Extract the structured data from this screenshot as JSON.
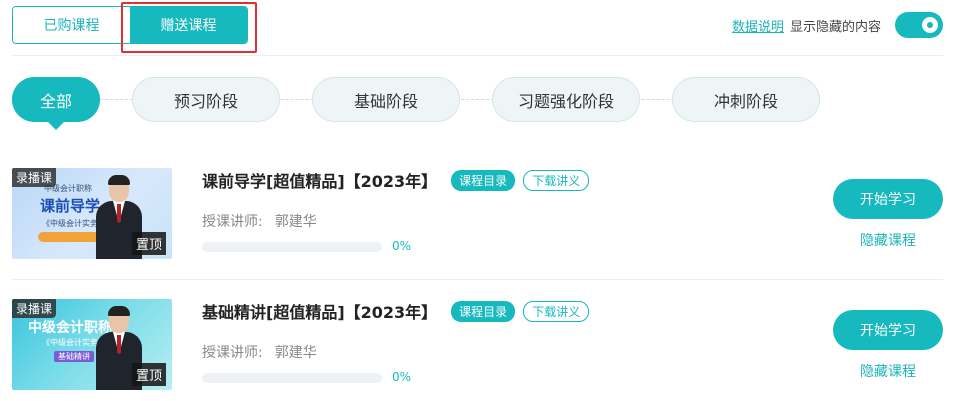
{
  "top_tabs": [
    {
      "label": "已购课程",
      "active": false
    },
    {
      "label": "赠送课程",
      "active": true
    }
  ],
  "top_right": {
    "data_link": "数据说明",
    "show_hidden_label": "显示隐藏的内容",
    "toggle_on": true
  },
  "stages": [
    {
      "label": "全部",
      "active": true
    },
    {
      "label": "预习阶段",
      "active": false
    },
    {
      "label": "基础阶段",
      "active": false
    },
    {
      "label": "习题强化阶段",
      "active": false
    },
    {
      "label": "冲刺阶段",
      "active": false
    }
  ],
  "courses": [
    {
      "title": "课前导学[超值精品]【2023年】",
      "catalog_tag": "课程目录",
      "download_tag": "下载讲义",
      "teacher_label": "授课讲师:",
      "teacher_name": "郭建华",
      "progress": 0,
      "progress_text": "0%",
      "start_label": "开始学习",
      "hide_label": "隐藏课程",
      "thumb": {
        "rec_badge": "录播课",
        "top_badge": "置顶",
        "line1": "中级会计职称",
        "line2": "课前导学",
        "line3": "《中级会计实务》"
      }
    },
    {
      "title": "基础精讲[超值精品]【2023年】",
      "catalog_tag": "课程目录",
      "download_tag": "下载讲义",
      "teacher_label": "授课讲师:",
      "teacher_name": "郭建华",
      "progress": 0,
      "progress_text": "0%",
      "start_label": "开始学习",
      "hide_label": "隐藏课程",
      "thumb": {
        "rec_badge": "录播课",
        "top_badge": "置顶",
        "line1": "中级会计职称",
        "line2": "《中级会计实务》",
        "line3": "基础精讲"
      }
    }
  ]
}
